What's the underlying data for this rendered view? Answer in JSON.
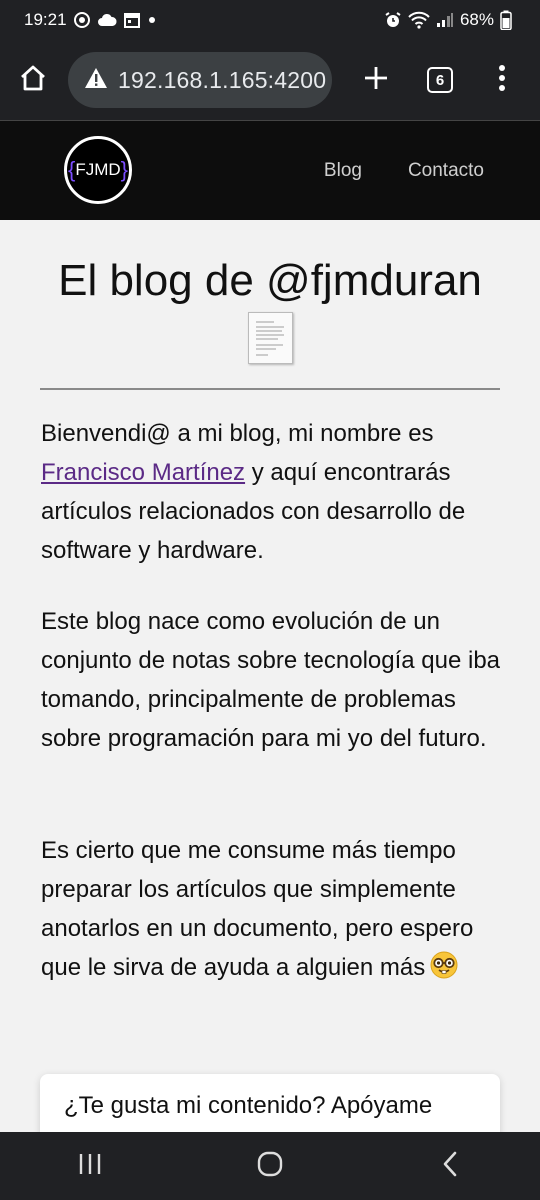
{
  "status_bar": {
    "time": "19:21",
    "battery": "68%"
  },
  "browser": {
    "url": "192.168.1.165:4200",
    "tab_count": "6"
  },
  "site": {
    "logo_text": "FJMD",
    "logo_brace_left": "{",
    "logo_brace_right": "}",
    "nav": [
      {
        "label": "Blog"
      },
      {
        "label": "Contacto"
      }
    ]
  },
  "main": {
    "title": "El blog de @fjmduran",
    "paragraphs": [
      {
        "before_link": "Bienvendi@ a mi blog, mi nombre es ",
        "link_text": "Francisco Martínez",
        "after_link": " y aquí encontrarás artículos relacionados con desarrollo de software y hardware."
      },
      {
        "text": "Este blog nace como evolución de un conjunto de notas sobre tecnología que iba tomando, principalmente de problemas sobre programación para mi yo del futuro."
      },
      {
        "text": "Es cierto que me consume más tiempo preparar los artículos que simplemente anotarlos en un documento, pero espero que le sirva de ayuda a alguien más"
      }
    ],
    "support_text": "¿Te gusta mi contenido? Apóyame"
  },
  "icons": {
    "status_left": [
      "whatsapp-icon",
      "cloud-icon",
      "calendar-icon",
      "dot-icon"
    ],
    "status_right": [
      "alarm-icon",
      "wifi-icon",
      "signal-icon",
      "battery-icon"
    ],
    "toolbar": [
      "home-icon",
      "warning-icon",
      "plus-icon",
      "tabs-icon",
      "more-vert-icon"
    ],
    "navbar": [
      "recents-icon",
      "home-nav-icon",
      "back-icon"
    ]
  }
}
